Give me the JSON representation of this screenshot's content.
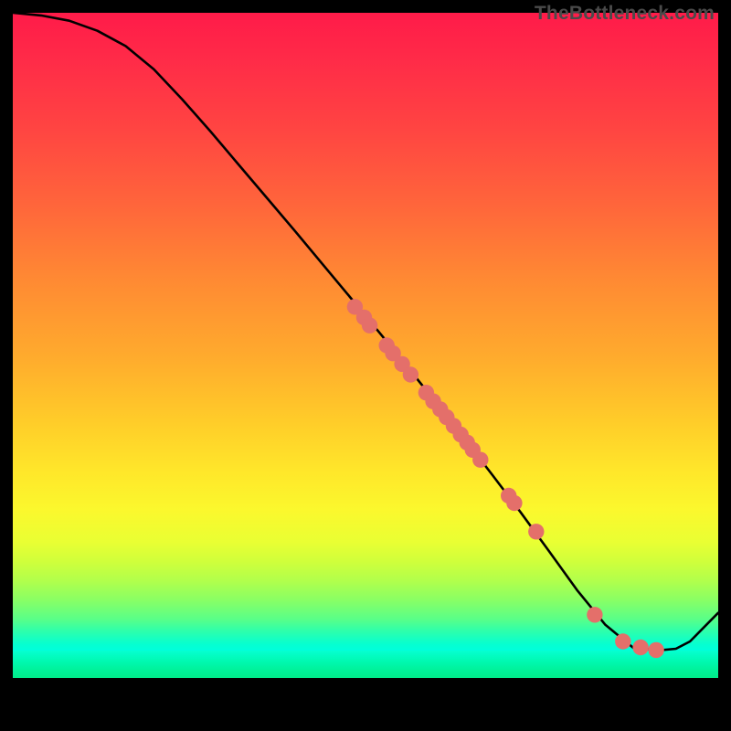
{
  "attribution": "TheBottleneck.com",
  "colors": {
    "curve_stroke": "#000000",
    "dot_fill": "#e46f6a",
    "dot_stroke": "#c9574f",
    "background": "#000000"
  },
  "chart_data": {
    "type": "line",
    "title": "",
    "xlabel": "",
    "ylabel": "",
    "xlim": [
      0,
      100
    ],
    "ylim": [
      0,
      100
    ],
    "series": [
      {
        "name": "curve",
        "x": [
          0,
          4,
          8,
          12,
          16,
          20,
          24,
          28,
          32,
          36,
          40,
          44,
          48,
          52,
          56,
          60,
          64,
          68,
          72,
          76,
          80,
          84,
          88,
          92,
          94,
          96,
          100
        ],
        "y": [
          100,
          99.6,
          98.8,
          97.3,
          95.0,
          91.5,
          87.0,
          82.2,
          77.2,
          72.2,
          67.2,
          62.1,
          57.0,
          51.9,
          46.7,
          41.4,
          36.0,
          30.5,
          24.9,
          19.1,
          13.2,
          8.0,
          4.5,
          4.2,
          4.4,
          5.5,
          9.8
        ]
      }
    ],
    "points": [
      {
        "x": 48.5,
        "y": 55.8
      },
      {
        "x": 49.8,
        "y": 54.2
      },
      {
        "x": 50.6,
        "y": 53.0
      },
      {
        "x": 53.0,
        "y": 50.0
      },
      {
        "x": 53.9,
        "y": 48.8
      },
      {
        "x": 55.2,
        "y": 47.2
      },
      {
        "x": 56.4,
        "y": 45.6
      },
      {
        "x": 58.6,
        "y": 42.9
      },
      {
        "x": 59.6,
        "y": 41.6
      },
      {
        "x": 60.6,
        "y": 40.4
      },
      {
        "x": 61.5,
        "y": 39.2
      },
      {
        "x": 62.5,
        "y": 37.9
      },
      {
        "x": 63.5,
        "y": 36.6
      },
      {
        "x": 64.4,
        "y": 35.4
      },
      {
        "x": 65.2,
        "y": 34.3
      },
      {
        "x": 66.3,
        "y": 32.8
      },
      {
        "x": 70.3,
        "y": 27.4
      },
      {
        "x": 71.1,
        "y": 26.3
      },
      {
        "x": 74.2,
        "y": 22.0
      },
      {
        "x": 82.5,
        "y": 9.5
      },
      {
        "x": 86.5,
        "y": 5.5
      },
      {
        "x": 89.0,
        "y": 4.6
      },
      {
        "x": 91.2,
        "y": 4.2
      }
    ]
  }
}
